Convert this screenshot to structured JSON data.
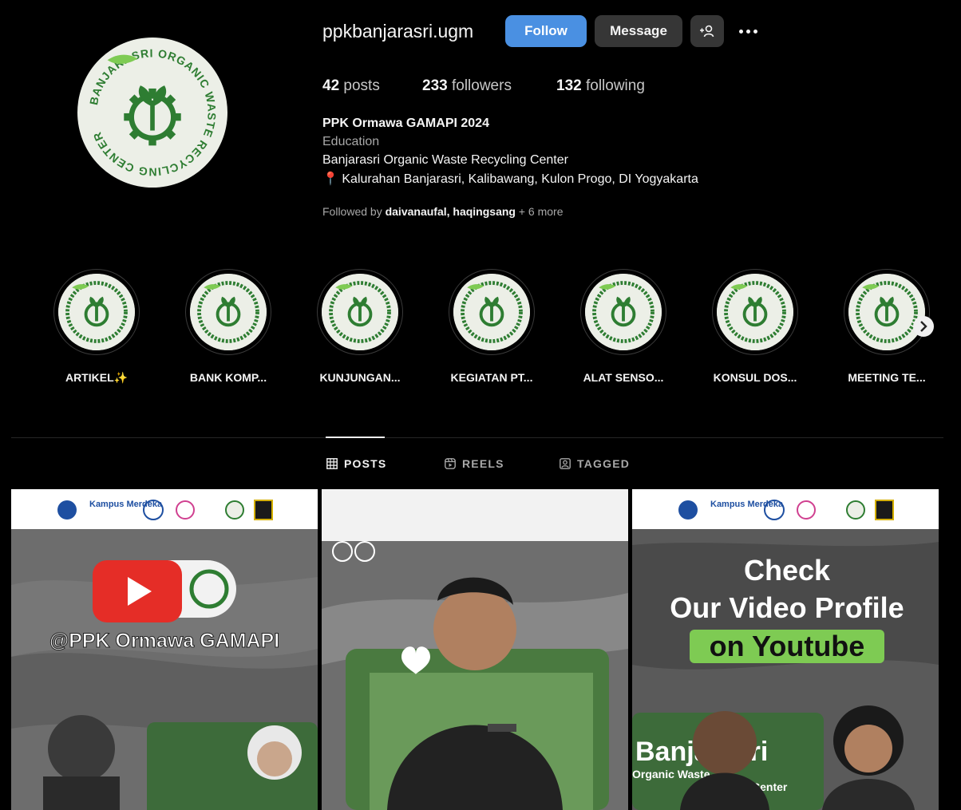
{
  "profile": {
    "username": "ppkbanjarasri.ugm",
    "logo_text": "BANJARASRI ORGANIC WASTE RECYCLING CENTER",
    "follow_label": "Follow",
    "message_label": "Message",
    "stats": {
      "posts_count": "42",
      "posts_label": "posts",
      "followers_count": "233",
      "followers_label": "followers",
      "following_count": "132",
      "following_label": "following"
    },
    "bio": {
      "name": "PPK Ormawa GAMAPI 2024",
      "category": "Education",
      "line1": "Banjarasri Organic Waste Recycling Center",
      "line2": "📍 Kalurahan Banjarasri, Kalibawang, Kulon Progo, DI Yogyakarta"
    },
    "followed_by": {
      "prefix": "Followed by ",
      "users": "daivanaufal, haqingsang",
      "more": " + 6 more"
    }
  },
  "highlights": [
    {
      "label": "ARTIKEL✨"
    },
    {
      "label": "BANK KOMP..."
    },
    {
      "label": "KUNJUNGAN..."
    },
    {
      "label": "KEGIATAN PT..."
    },
    {
      "label": "ALAT SENSO..."
    },
    {
      "label": "KONSUL DOS..."
    },
    {
      "label": "MEETING TE..."
    }
  ],
  "tabs": [
    {
      "label": "POSTS",
      "active": true
    },
    {
      "label": "REELS",
      "active": false
    },
    {
      "label": "TAGGED",
      "active": false
    }
  ],
  "posts": [
    {
      "logo_text": "Kampus Merdeka",
      "headline": "@PPK Ormawa GAMAPI"
    },
    {
      "headline": ""
    },
    {
      "logo_text": "Kampus Merdeka",
      "headline_1": "Check",
      "headline_2": "Our Video Profile",
      "headline_3": "on Youtube",
      "overlay_text": "Banjarasri",
      "overlay_sub": "Organic Waste",
      "overlay_sub2": "Center"
    }
  ],
  "colors": {
    "follow_blue": "#4a90e2",
    "logo_green": "#2e7d32",
    "youtube_red": "#e52d27",
    "highlight_green": "#7ecb53"
  }
}
